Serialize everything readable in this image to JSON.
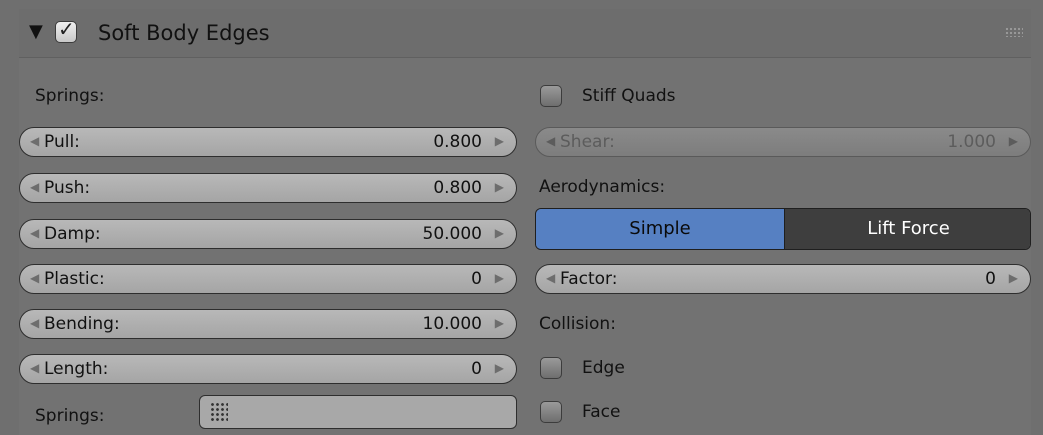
{
  "panel": {
    "title": "Soft Body Edges",
    "enabled": true
  },
  "left": {
    "springs_heading": "Springs:",
    "fields": [
      {
        "label": "Pull:",
        "value": "0.800"
      },
      {
        "label": "Push:",
        "value": "0.800"
      },
      {
        "label": "Damp:",
        "value": "50.000"
      },
      {
        "label": "Plastic:",
        "value": "0"
      },
      {
        "label": "Bending:",
        "value": "10.000"
      },
      {
        "label": "Length:",
        "value": "0"
      }
    ],
    "springs_group_label": "Springs:"
  },
  "right": {
    "stiff_quads_label": "Stiff Quads",
    "stiff_quads_checked": false,
    "shear": {
      "label": "Shear:",
      "value": "1.000",
      "disabled": true
    },
    "aerodynamics_label": "Aerodynamics:",
    "aero_options": [
      "Simple",
      "Lift Force"
    ],
    "aero_selected": "Simple",
    "factor": {
      "label": "Factor:",
      "value": "0"
    },
    "collision_label": "Collision:",
    "edge_label": "Edge",
    "edge_checked": false,
    "face_label": "Face",
    "face_checked": false
  },
  "colors": {
    "active_option": "#5680c2",
    "inactive_option": "#3e3e3e"
  }
}
